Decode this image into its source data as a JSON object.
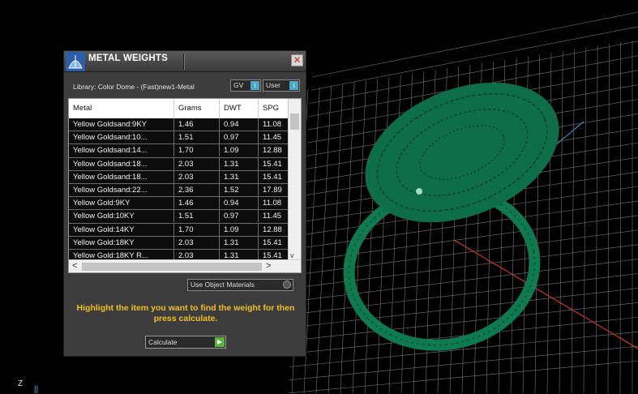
{
  "panel": {
    "title": "METAL WEIGHTS",
    "close_glyph": "✕",
    "library_label": "Library: Color Dome - (Fast)new1-Metal",
    "toggles": [
      {
        "label": "GV",
        "knob": "I"
      },
      {
        "label": "User",
        "knob": "I"
      }
    ],
    "table": {
      "headers": [
        "Metal",
        "Grams",
        "DWT",
        "SPG"
      ],
      "rows": [
        [
          "Yellow Goldsand:9KY",
          "1.46",
          "0.94",
          "11.08"
        ],
        [
          "Yellow Goldsand:10...",
          "1.51",
          "0.97",
          "11.45"
        ],
        [
          "Yellow Goldsand:14...",
          "1.70",
          "1.09",
          "12.88"
        ],
        [
          "Yellow Goldsand:18...",
          "2.03",
          "1.31",
          "15.41"
        ],
        [
          "Yellow Goldsand:18...",
          "2.03",
          "1.31",
          "15.41"
        ],
        [
          "Yellow Goldsand:22...",
          "2.36",
          "1.52",
          "17.89"
        ],
        [
          "Yellow Gold:9KY",
          "1.46",
          "0.94",
          "11.08"
        ],
        [
          "Yellow Gold:10KY",
          "1.51",
          "0.97",
          "11.45"
        ],
        [
          "Yellow Gold:14KY",
          "1.70",
          "1.09",
          "12.88"
        ],
        [
          "Yellow Gold:18KY",
          "2.03",
          "1.31",
          "15.41"
        ],
        [
          "Yellow Gold:18KY R...",
          "2.03",
          "1.31",
          "15.41"
        ]
      ],
      "scroll_down_glyph": "v",
      "scroll_left_glyph": "<",
      "scroll_right_glyph": ">"
    },
    "use_object_materials": "Use Object Materials",
    "hint": "Highlight the item you want to find the weight for then press calculate.",
    "calculate_label": "Calculate",
    "calculate_glyph": "▶"
  },
  "viewport": {
    "axis_z": "Z",
    "axis_marker": "||",
    "model_color": "#0f7a52",
    "grid_color": "#8a8a8a"
  }
}
